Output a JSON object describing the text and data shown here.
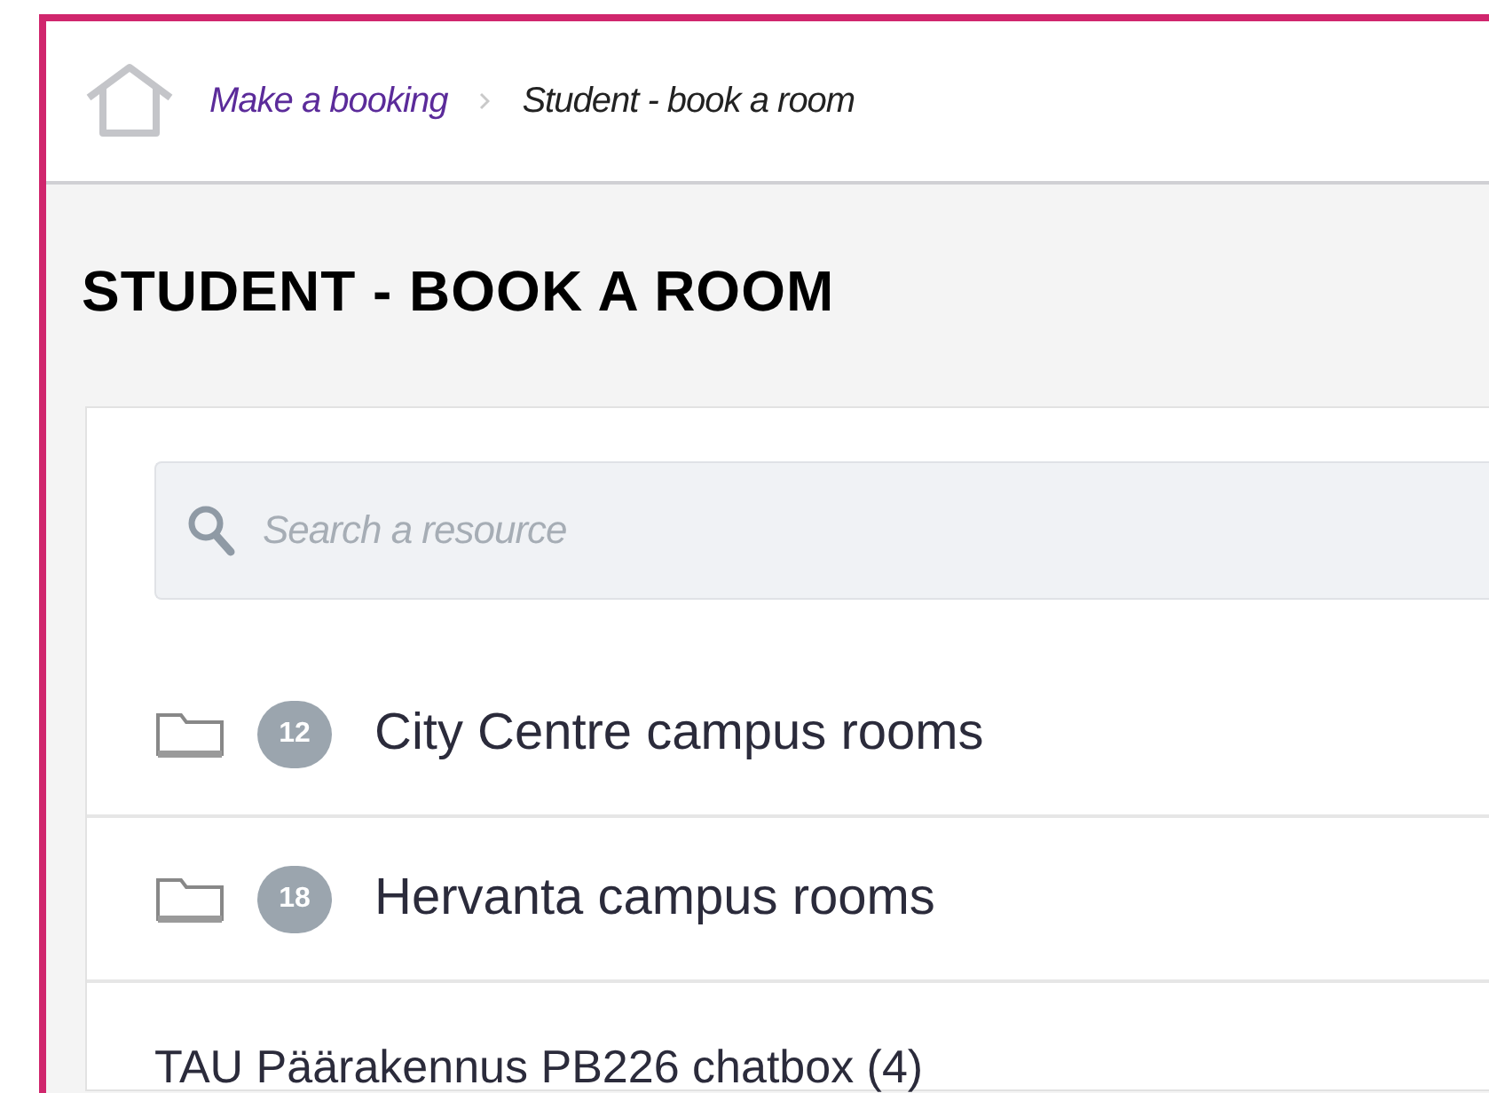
{
  "breadcrumb": [
    {
      "label": "Make a booking",
      "kind": "link"
    },
    {
      "label": "Student - book a room",
      "kind": "current"
    }
  ],
  "title": "STUDENT - BOOK A ROOM",
  "search": {
    "placeholder": "Search a resource"
  },
  "items": [
    {
      "kind": "folder",
      "count": "12",
      "label": "City Centre campus rooms"
    },
    {
      "kind": "folder",
      "count": "18",
      "label": "Hervanta campus rooms"
    },
    {
      "kind": "resource",
      "label": "TAU Päärakennus PB226 chatbox (4)"
    }
  ]
}
